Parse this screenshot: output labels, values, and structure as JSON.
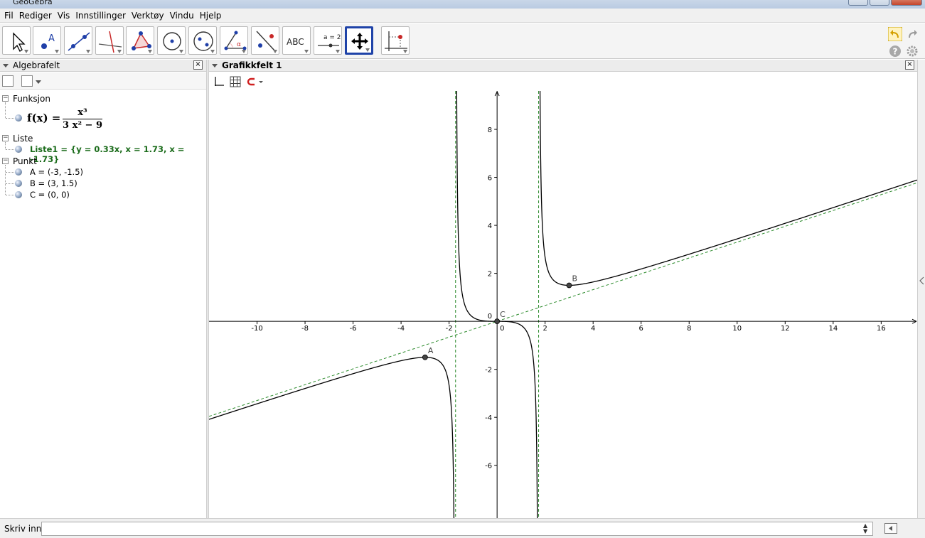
{
  "window": {
    "title": "GeoGebra"
  },
  "menu": [
    "Fil",
    "Rediger",
    "Vis",
    "Innstillinger",
    "Verktøy",
    "Vindu",
    "Hjelp"
  ],
  "toolbar": {
    "tools": [
      {
        "icon": "move-arrow-icon"
      },
      {
        "icon": "point-icon",
        "label": "A"
      },
      {
        "icon": "line-through-two-points-icon"
      },
      {
        "icon": "perpendicular-line-icon"
      },
      {
        "icon": "polygon-icon"
      },
      {
        "icon": "circle-center-point-icon"
      },
      {
        "icon": "ellipse-icon"
      },
      {
        "icon": "angle-icon",
        "label": "α"
      },
      {
        "icon": "reflect-about-line-icon"
      },
      {
        "icon": "text-icon",
        "label": "ABC"
      },
      {
        "icon": "slider-icon",
        "label": "a = 2"
      },
      {
        "icon": "move-graphics-view-icon",
        "active": true
      },
      {
        "icon": "graphics-view-options-icon"
      }
    ],
    "right": [
      "undo-icon",
      "redo-icon",
      "help-icon",
      "settings-icon"
    ]
  },
  "algebra": {
    "title": "Algebrafelt",
    "categories": [
      {
        "name": "Funksjon",
        "items": [
          {
            "kind": "formula",
            "lhs": "f(x) =",
            "numerator": "x³",
            "denominator": "3 x² − 9"
          }
        ]
      },
      {
        "name": "Liste",
        "items": [
          {
            "kind": "text",
            "text": "Liste1 = {y = 0.33x, x = 1.73, x = -1.73}",
            "color": "#1a6b1a"
          }
        ]
      },
      {
        "name": "Punkt",
        "items": [
          {
            "kind": "text",
            "text": "A = (-3, -1.5)"
          },
          {
            "kind": "text",
            "text": "B = (3, 1.5)"
          },
          {
            "kind": "text",
            "text": "C = (0, 0)"
          }
        ]
      }
    ]
  },
  "graphics": {
    "title": "Grafikkfelt 1",
    "x_range": [
      -12,
      17.5
    ],
    "y_range": [
      -8.2,
      9.6
    ],
    "x_ticks": [
      -10,
      -8,
      -6,
      -4,
      -2,
      0,
      2,
      4,
      6,
      8,
      10,
      12,
      14,
      16
    ],
    "y_ticks": [
      -6,
      -4,
      -2,
      2,
      4,
      6,
      8
    ],
    "origin_label": "0",
    "asymptote_slope": 0.33,
    "vertical_asymptotes": [
      -1.73,
      1.73
    ],
    "points": [
      {
        "name": "A",
        "x": -3,
        "y": -1.5
      },
      {
        "name": "B",
        "x": 3,
        "y": 1.5
      },
      {
        "name": "C",
        "x": 0,
        "y": 0
      }
    ],
    "curve_color": "#000000",
    "asymptote_color": "#2a8a2a"
  },
  "input": {
    "label": "Skriv inn:",
    "value": ""
  }
}
